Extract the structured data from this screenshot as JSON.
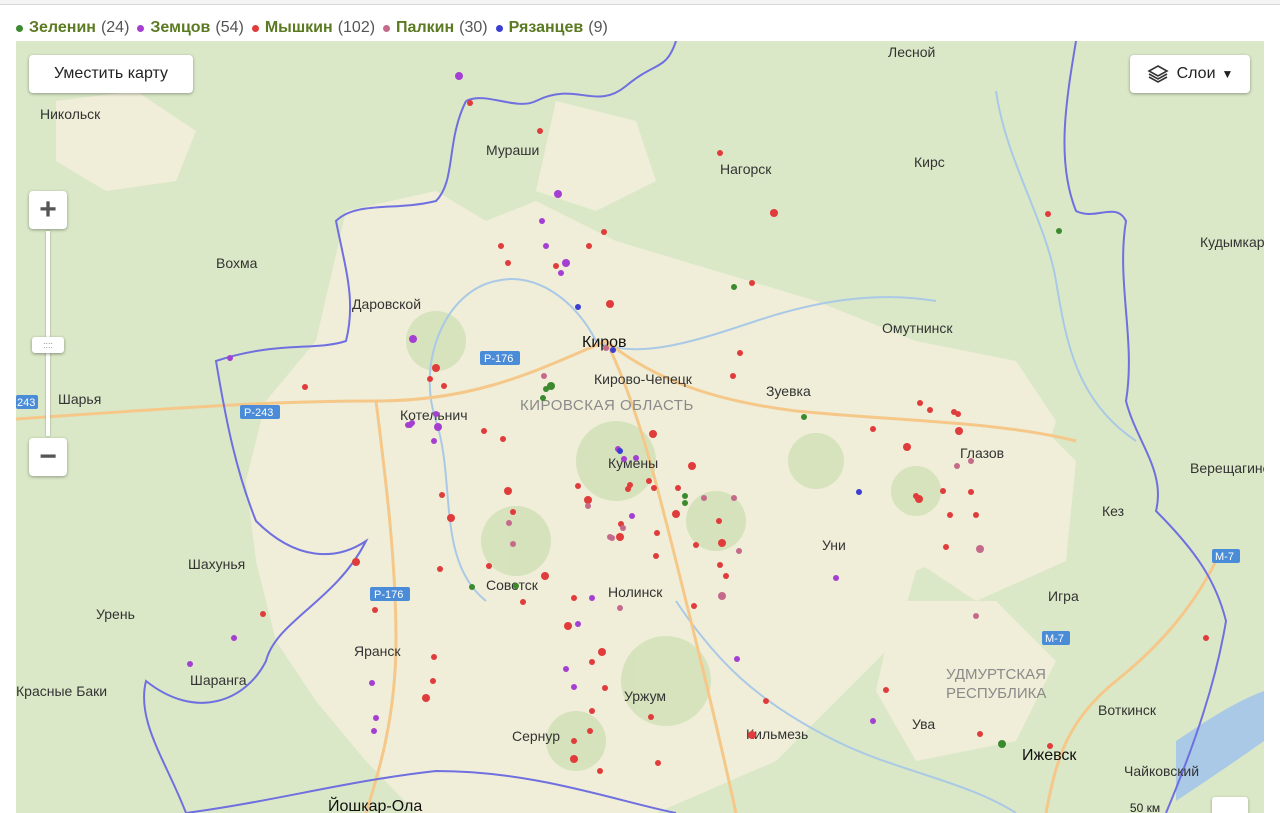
{
  "legend": [
    {
      "name": "Зеленин",
      "count": "(24)",
      "color": "#3c8a2e"
    },
    {
      "name": "Земцов",
      "count": "(54)",
      "color": "#a43fd1"
    },
    {
      "name": "Мышкин",
      "count": "(102)",
      "color": "#e03c3c"
    },
    {
      "name": "Палкин",
      "count": "(30)",
      "color": "#c46a8a"
    },
    {
      "name": "Рязанцев",
      "count": "(9)",
      "color": "#3b3fd1"
    }
  ],
  "controls": {
    "fit_label": "Уместить карту",
    "layers_label": "Слои",
    "zoom_in": "+",
    "zoom_out": "−",
    "zoom_handle": "::::",
    "scale_label": "50 км"
  },
  "region_label": "КИРОВСКАЯ ОБЛАСТЬ",
  "region_label_2a": "УДМУРТСКАЯ",
  "region_label_2b": "РЕСПУБЛИКА",
  "cities": [
    {
      "name": "Лесной"
    },
    {
      "name": "Никольск"
    },
    {
      "name": "Мураши"
    },
    {
      "name": "Нагорск"
    },
    {
      "name": "Кирс"
    },
    {
      "name": "Кудымкар"
    },
    {
      "name": "Вохма"
    },
    {
      "name": "Даровской"
    },
    {
      "name": "Киров"
    },
    {
      "name": "Омутнинск"
    },
    {
      "name": "Кирово-Чепецк"
    },
    {
      "name": "Зуевка"
    },
    {
      "name": "Шарья"
    },
    {
      "name": "Котельнич"
    },
    {
      "name": "Глазов"
    },
    {
      "name": "Кумёны"
    },
    {
      "name": "Верещагино"
    },
    {
      "name": "Кез"
    },
    {
      "name": "Уни"
    },
    {
      "name": "Шахунья"
    },
    {
      "name": "Советск"
    },
    {
      "name": "Нолинск"
    },
    {
      "name": "Игра"
    },
    {
      "name": "Урень"
    },
    {
      "name": "Яранск"
    },
    {
      "name": "Шаранга"
    },
    {
      "name": "Красные Баки"
    },
    {
      "name": "Уржум"
    },
    {
      "name": "Сернур"
    },
    {
      "name": "Кильмезь"
    },
    {
      "name": "Ува"
    },
    {
      "name": "Воткинск"
    },
    {
      "name": "Ижевск"
    },
    {
      "name": "Чайковский"
    },
    {
      "name": "Йошкар-Ола"
    }
  ],
  "roads": [
    {
      "label": "Р-176"
    },
    {
      "label": "Р-243"
    },
    {
      "label": "Р-176"
    },
    {
      "label": "М-7"
    },
    {
      "label": "М-7"
    },
    {
      "label": "243"
    }
  ],
  "markers": [
    {
      "lon": 48.6,
      "lat": 59.8,
      "who": "Мышкин"
    },
    {
      "lon": 49.7,
      "lat": 58.6,
      "who": "Мышкин"
    }
  ]
}
